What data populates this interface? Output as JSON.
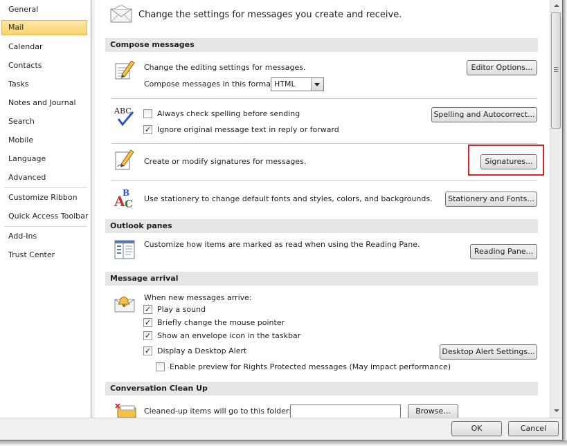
{
  "sidebar": {
    "items": [
      {
        "label": "General"
      },
      {
        "label": "Mail",
        "selected": true
      },
      {
        "label": "Calendar"
      },
      {
        "label": "Contacts"
      },
      {
        "label": "Tasks"
      },
      {
        "label": "Notes and Journal"
      },
      {
        "label": "Search"
      },
      {
        "label": "Mobile"
      },
      {
        "label": "Language"
      },
      {
        "label": "Advanced"
      },
      {
        "label": "Customize Ribbon"
      },
      {
        "label": "Quick Access Toolbar"
      },
      {
        "label": "Add-Ins"
      },
      {
        "label": "Trust Center"
      }
    ]
  },
  "header": {
    "text": "Change the settings for messages you create and receive.",
    "icon": "envelope-icon"
  },
  "compose": {
    "title": "Compose messages",
    "editing_text": "Change the editing settings for messages.",
    "editor_button": "Editor Options...",
    "format_label": "Compose messages in this format:",
    "format_value": "HTML",
    "spell_always": "Always check spelling before sending",
    "spell_always_checked": false,
    "spell_ignore": "Ignore original message text in reply or forward",
    "spell_ignore_checked": true,
    "spelling_button": "Spelling and Autocorrect...",
    "signatures_text": "Create or modify signatures for messages.",
    "signatures_button": "Signatures...",
    "stationery_text": "Use stationery to change default fonts and styles, colors, and backgrounds.",
    "stationery_button": "Stationery and Fonts...",
    "spell_icon_text": "ABC",
    "stationery_icon_letters": {
      "a": "A",
      "b": "B",
      "c": "C"
    }
  },
  "panes": {
    "title": "Outlook panes",
    "text": "Customize how items are marked as read when using the Reading Pane.",
    "button": "Reading Pane..."
  },
  "arrival": {
    "title": "Message arrival",
    "when_label": "When new messages arrive:",
    "options": [
      {
        "label": "Play a sound",
        "checked": true
      },
      {
        "label": "Briefly change the mouse pointer",
        "checked": true
      },
      {
        "label": "Show an envelope icon in the taskbar",
        "checked": true
      },
      {
        "label": "Display a Desktop Alert",
        "checked": true
      }
    ],
    "preview_label": "Enable preview for Rights Protected messages (May impact performance)",
    "preview_checked": false,
    "alert_button": "Desktop Alert Settings..."
  },
  "cleanup": {
    "title": "Conversation Clean Up",
    "folder_label": "Cleaned-up items will go to this folder:",
    "folder_value": "",
    "browse_button": "Browse..."
  },
  "footer": {
    "ok": "OK",
    "cancel": "Cancel"
  },
  "colors": {
    "selected_bg": "#fbd46e",
    "highlight": "#e21e26",
    "section_bg": "#e6e6e6"
  }
}
